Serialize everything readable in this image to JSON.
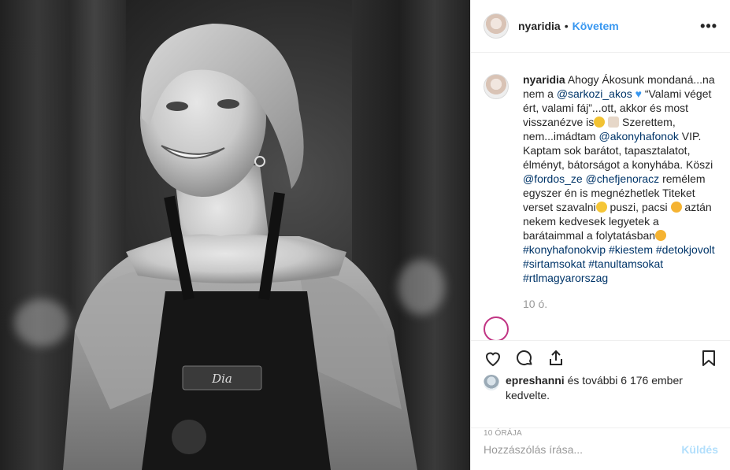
{
  "post": {
    "username": "nyaridia",
    "follow_label": "Követem",
    "separator": "•",
    "more_label": "•••",
    "caption": {
      "username": "nyaridia",
      "text1": " Ahogy Ákosunk mondaná...na nem a ",
      "mention1": "@sarkozi_akos",
      "text2": " “Valami véget ért, valami fáj”...ott, akkor és most visszanézve is",
      "text3": " Szerettem, nem...imádtam ",
      "mention2": "@akonyhafonok",
      "text4": " VIP. Kaptam sok barátot, tapasztalatot, élményt, bátorságot a konyhába. Köszi ",
      "mention3": "@fordos_ze",
      "text5": " ",
      "mention4": "@chefjenoracz",
      "text6": " remélem egyszer én is megnézhetlek Titeket verset szavalni",
      "text7": " puszi, pacsi ",
      "text8": " aztán nekem kedvesek legyetek a barátaimmal a folytatásban",
      "tags": [
        "#konyhafonokvip",
        "#kiestem",
        "#detokjovolt",
        "#sirtamsokat",
        "#tanultamsokat",
        "#rtlmagyarorszag"
      ]
    },
    "caption_time": "10 ó.",
    "next_comment_preview": "",
    "likes": {
      "user": "epreshanni",
      "rest": " és további 6 176 ember kedvelte."
    },
    "date_label": "10 ÓRÁJA",
    "comment_placeholder": "Hozzászólás írása...",
    "send_label": "Küldés",
    "photo": {
      "apron_name": "Dia"
    }
  },
  "icons": {
    "heart": "heart-icon",
    "comment": "comment-icon",
    "share": "share-icon",
    "save": "bookmark-icon"
  },
  "colors": {
    "accent": "#3897f0",
    "link": "#003569",
    "muted": "#999999",
    "send_disabled": "#b2dffc"
  }
}
